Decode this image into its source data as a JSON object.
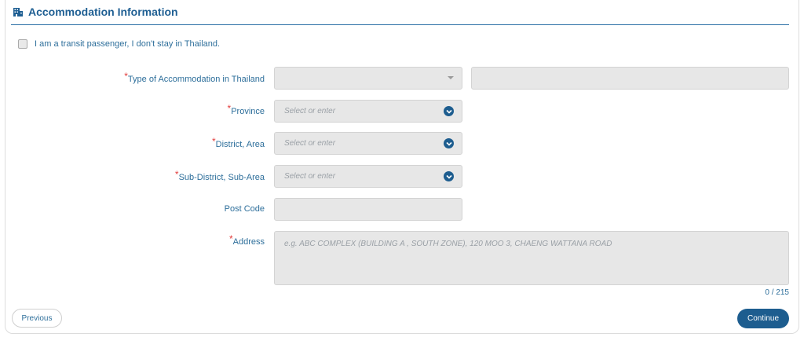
{
  "section": {
    "title": "Accommodation Information",
    "icon": "building-icon"
  },
  "transit": {
    "label": "I am a transit passenger, I don't stay in Thailand.",
    "checked": false
  },
  "fields": {
    "accommodation_type": {
      "label": "Type of Accommodation in Thailand",
      "value": ""
    },
    "province": {
      "label": "Province",
      "placeholder": "Select or enter"
    },
    "district": {
      "label": "District, Area",
      "placeholder": "Select or enter"
    },
    "subdistrict": {
      "label": "Sub-District, Sub-Area",
      "placeholder": "Select or enter"
    },
    "postcode": {
      "label": "Post Code",
      "value": ""
    },
    "address": {
      "label": "Address",
      "placeholder": "e.g. ABC COMPLEX (BUILDING A , SOUTH ZONE), 120 MOO 3, CHAENG WATTANA ROAD",
      "counter": "0 / 215"
    }
  },
  "required_marker": "*",
  "buttons": {
    "previous": "Previous",
    "continue": "Continue"
  },
  "colors": {
    "accent": "#1d5d8f",
    "required": "#e23b3b",
    "field_bg": "#e7e7e7"
  }
}
